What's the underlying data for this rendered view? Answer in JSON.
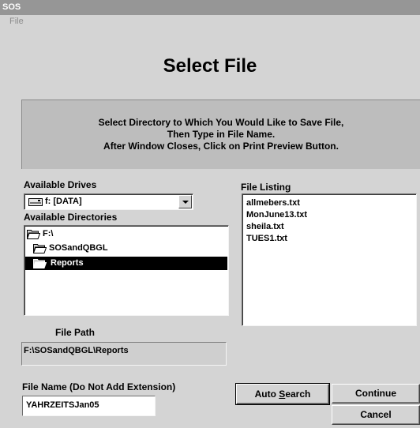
{
  "window": {
    "title": "SOS"
  },
  "menu": {
    "items": [
      "File"
    ]
  },
  "page_title": "Select File",
  "instructions": [
    "Select Directory to Which You Would Like to Save File,",
    "Then Type in File Name.",
    "After Window Closes, Click on Print Preview Button."
  ],
  "drives": {
    "label": "Available Drives",
    "selected": "f: [DATA]"
  },
  "directories": {
    "label": "Available Directories",
    "items": [
      {
        "name": "F:\\",
        "state": "open"
      },
      {
        "name": "SOSandQBGL",
        "state": "open"
      },
      {
        "name": "Reports",
        "state": "open",
        "selected": true
      }
    ]
  },
  "file_listing": {
    "label": "File Listing",
    "files": [
      "allmebers.txt",
      "MonJune13.txt",
      "sheila.txt",
      "TUES1.txt"
    ]
  },
  "file_path": {
    "label": "File Path",
    "value": "F:\\SOSandQBGL\\Reports"
  },
  "file_name": {
    "label": "File Name (Do Not Add Extension)",
    "value": "YAHRZEITSJan05"
  },
  "buttons": {
    "auto_search_prefix": "Auto ",
    "auto_search_mnemonic": "S",
    "auto_search_suffix": "earch",
    "continue": "Continue",
    "cancel": "Cancel"
  },
  "colors": {
    "selection": "#000000",
    "titlebar": "#969696",
    "panel": "#bdbdbd"
  }
}
